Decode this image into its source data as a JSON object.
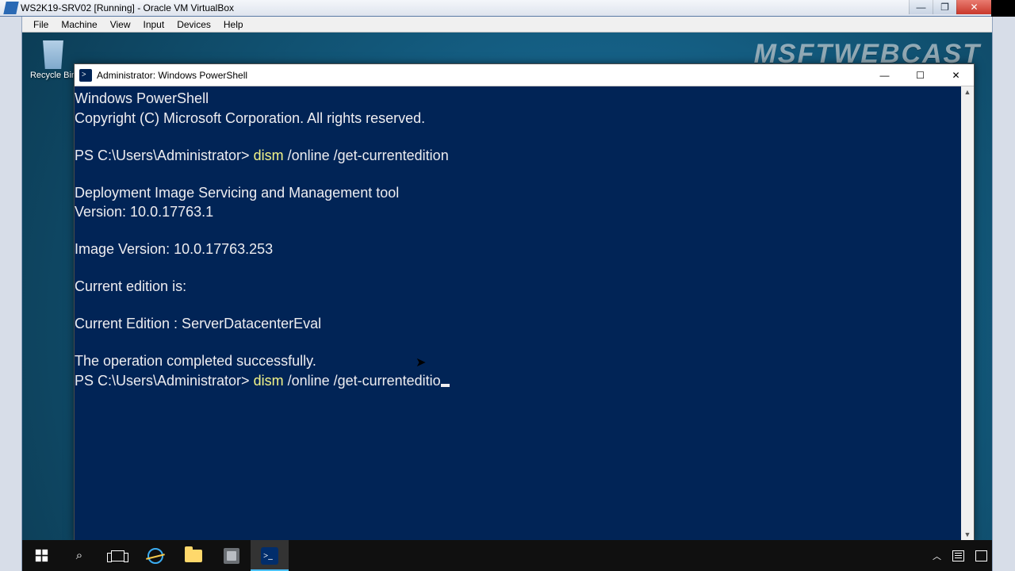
{
  "host": {
    "title": "WS2K19-SRV02 [Running] - Oracle VM VirtualBox",
    "menu": {
      "file": "File",
      "machine": "Machine",
      "view": "View",
      "input": "Input",
      "devices": "Devices",
      "help": "Help"
    },
    "btn": {
      "min": "—",
      "max": "❐",
      "close": "✕"
    }
  },
  "desktop": {
    "watermark": "MSFTWEBCAST",
    "recycle_bin": "Recycle Bin"
  },
  "ps": {
    "title": "Administrator: Windows PowerShell",
    "btn": {
      "min": "—",
      "max": "☐",
      "close": "✕"
    },
    "line1": "Windows PowerShell",
    "line2": "Copyright (C) Microsoft Corporation. All rights reserved.",
    "prompt1_pre": "PS C:\\Users\\Administrator> ",
    "prompt1_cmd": "dism",
    "prompt1_args": " /online /get-currentedition",
    "out1": "Deployment Image Servicing and Management tool",
    "out2": "Version: 10.0.17763.1",
    "out3": "Image Version: 10.0.17763.253",
    "out4": "Current edition is:",
    "out5": "Current Edition : ServerDatacenterEval",
    "out6": "The operation completed successfully.",
    "prompt2_pre": "PS C:\\Users\\Administrator> ",
    "prompt2_cmd": "dism",
    "prompt2_args": " /online /get-currenteditio"
  },
  "taskbar": {
    "items": [
      "start",
      "search",
      "task-view",
      "ie",
      "explorer",
      "server-manager",
      "powershell"
    ]
  }
}
